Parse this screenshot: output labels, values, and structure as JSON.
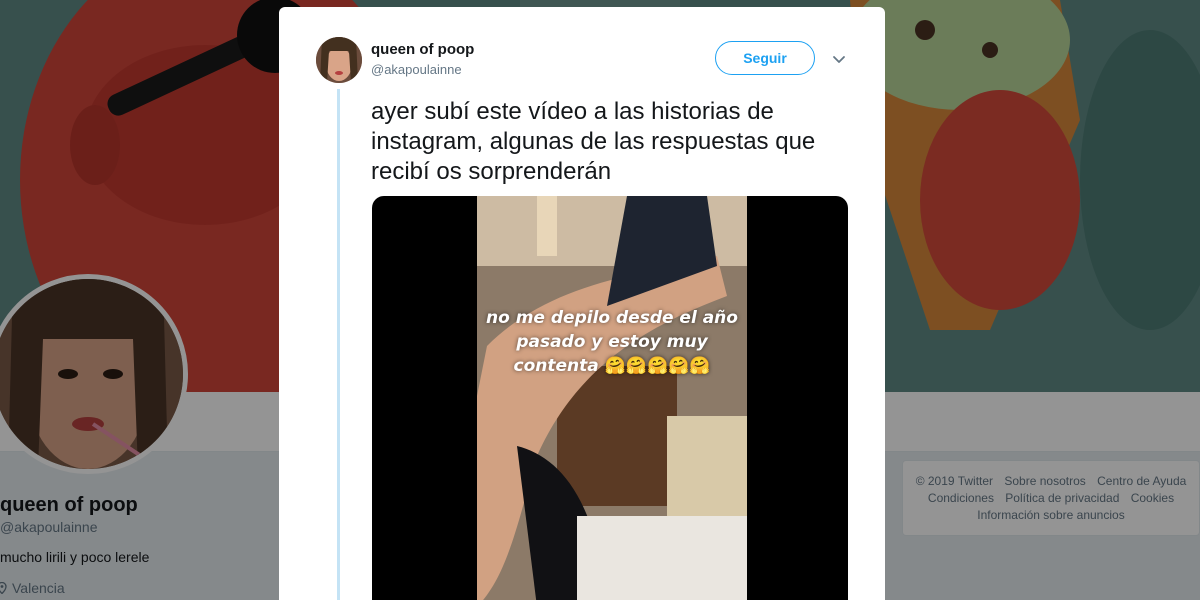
{
  "profile": {
    "name": "queen of poop",
    "handle": "@akapoulainne",
    "bio": "mucho lirili y poco lerele",
    "location": "Valencia"
  },
  "footer": {
    "row1": [
      "© 2019 Twitter",
      "Sobre nosotros",
      "Centro de Ayuda"
    ],
    "row2": [
      "Condiciones",
      "Política de privacidad",
      "Cookies"
    ],
    "row3": [
      "Información sobre anuncios"
    ]
  },
  "tweet": {
    "author_name": "queen of poop",
    "author_handle": "@akapoulainne",
    "follow_label": "Seguir",
    "text": "ayer subí este vídeo a las historias de instagram, algunas de las respuestas que recibí os sorprenderán",
    "video_caption": "no me depilo desde el año pasado y estoy muy contenta",
    "video_caption_emoji": "🤗🤗🤗🤗🤗"
  },
  "colors": {
    "accent": "#1da1f2",
    "thread_line": "#c4e3f5",
    "text_primary": "#14171a",
    "text_secondary": "#657786"
  },
  "icons": {
    "caret": "chevron-down-icon",
    "location": "map-pin-icon"
  }
}
